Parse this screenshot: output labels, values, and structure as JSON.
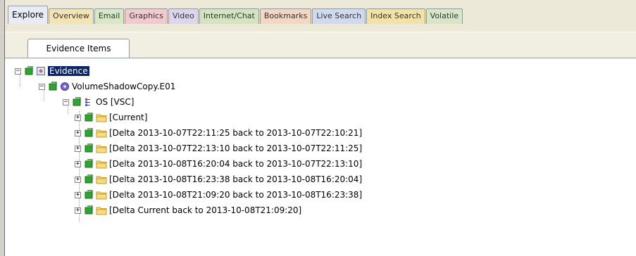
{
  "tabs": [
    {
      "label": "Explore",
      "color": "#e9ecf7",
      "active": true
    },
    {
      "label": "Overview",
      "color": "#f4e4b3"
    },
    {
      "label": "Email",
      "color": "#d6e8c6"
    },
    {
      "label": "Graphics",
      "color": "#f2c9cf"
    },
    {
      "label": "Video",
      "color": "#dcd5ee"
    },
    {
      "label": "Internet/Chat",
      "color": "#d2e5c0"
    },
    {
      "label": "Bookmarks",
      "color": "#f3d6c4"
    },
    {
      "label": "Live Search",
      "color": "#cfd9f0"
    },
    {
      "label": "Index Search",
      "color": "#f2e2a6"
    },
    {
      "label": "Volatile",
      "color": "#d7e6c7"
    }
  ],
  "subtab": {
    "label": "Evidence Items"
  },
  "tree": {
    "root": {
      "label": "Evidence",
      "expander": "−",
      "icon": "evidence-icon"
    },
    "image": {
      "label": "VolumeShadowCopy.E01",
      "expander": "−",
      "icon": "disk-image-icon"
    },
    "volume": {
      "label": "OS [VSC]",
      "expander": "−",
      "icon": "volume-icon"
    },
    "items": [
      {
        "label": "[Current]",
        "expander": "+"
      },
      {
        "label": "[Delta 2013-10-07T22:11:25 back to 2013-10-07T22:10:21]",
        "expander": "+"
      },
      {
        "label": "[Delta 2013-10-07T22:13:10 back to 2013-10-07T22:11:25]",
        "expander": "+"
      },
      {
        "label": "[Delta 2013-10-08T16:20:04 back to 2013-10-07T22:13:10]",
        "expander": "+"
      },
      {
        "label": "[Delta 2013-10-08T16:23:38 back to 2013-10-08T16:20:04]",
        "expander": "+"
      },
      {
        "label": "[Delta 2013-10-08T21:09:20 back to 2013-10-08T16:23:38]",
        "expander": "+"
      },
      {
        "label": "[Delta Current back to 2013-10-08T21:09:20]",
        "expander": "+"
      }
    ]
  }
}
